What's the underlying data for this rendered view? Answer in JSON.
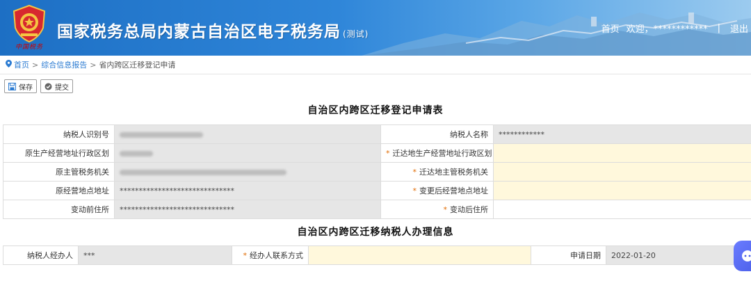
{
  "header": {
    "title": "国家税务总局内蒙古自治区电子税务局",
    "title_suffix": "(测试)",
    "brand_sub": "中国税务",
    "home": "首页",
    "welcome": "欢迎，************",
    "separator": "|",
    "logout": "退出"
  },
  "breadcrumb": {
    "home": "首页",
    "parent": "综合信息报告",
    "current": "省内跨区迁移登记申请"
  },
  "toolbar": {
    "save_label": "保存",
    "submit_label": "提交"
  },
  "section1": {
    "title": "自治区内跨区迁移登记申请表",
    "taxpayer_id_label": "纳税人识别号",
    "taxpayer_name_label": "纳税人名称",
    "taxpayer_name_value": "************",
    "orig_region_label": "原生产经营地址行政区划",
    "dest_region_label": "迁达地生产经营地址行政区划",
    "orig_tax_office_label": "原主管税务机关",
    "dest_tax_office_label": "迁达地主管税务机关",
    "orig_address_label": "原经营地点地址",
    "orig_address_value": "******************************",
    "new_address_label": "变更后经营地点地址",
    "prev_residence_label": "变动前住所",
    "prev_residence_value": "******************************",
    "new_residence_label": "变动后住所"
  },
  "section2": {
    "title": "自治区内跨区迁移纳税人办理信息",
    "agent_label": "纳税人经办人",
    "agent_value": "***",
    "agent_contact_label": "经办人联系方式",
    "apply_date_label": "申请日期",
    "apply_date_value": "2022-01-20"
  },
  "required_mark": "*"
}
